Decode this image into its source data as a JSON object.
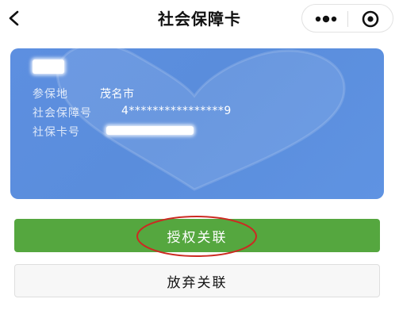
{
  "header": {
    "title": "社会保障卡",
    "back_icon": "chevron-left-icon",
    "more_icon": "more-dots-icon",
    "target_icon": "target-icon"
  },
  "card": {
    "background_color": "#5a8ddc",
    "city_label": "参保地",
    "city_value": "茂名市",
    "ssn_label": "社会保障号",
    "ssn_value": "4****************9",
    "card_no_label": "社保卡号"
  },
  "actions": {
    "authorize_label": "授权关联",
    "authorize_color": "#55a73f",
    "abandon_label": "放弃关联"
  }
}
